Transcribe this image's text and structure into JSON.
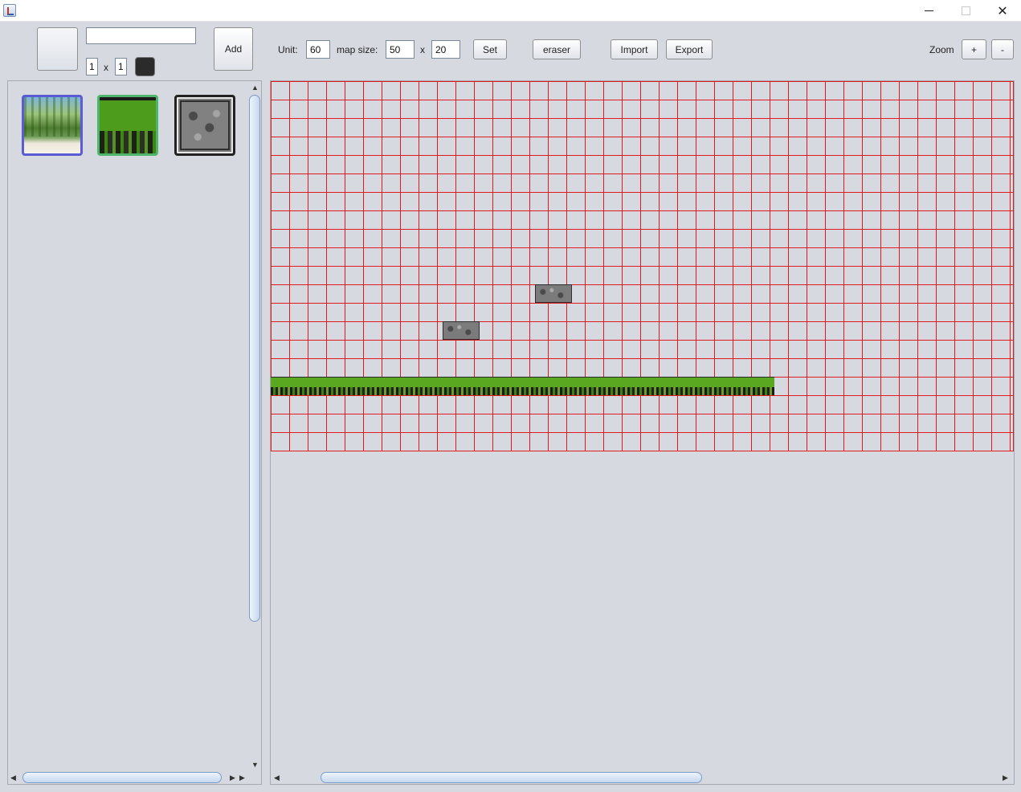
{
  "window": {
    "minimize_glyph": "",
    "maximize_glyph": "",
    "close_glyph": "✕"
  },
  "toolbar": {
    "name_value": "",
    "width_value": "1",
    "x_sep": "x",
    "height_value": "1",
    "add_label": "Add",
    "unit_label": "Unit:",
    "unit_value": "60",
    "map_size_label": "map size:",
    "map_width_value": "50",
    "map_x_sep": "x",
    "map_height_value": "20",
    "set_label": "Set",
    "eraser_label": "eraser",
    "import_label": "Import",
    "export_label": "Export",
    "zoom_label": "Zoom",
    "zoom_in_label": "+",
    "zoom_out_label": "-",
    "swatch_color": "#2b2b2b"
  },
  "palette": {
    "tiles": [
      {
        "icon": "jungle-background-tile",
        "selected": true
      },
      {
        "icon": "grass-tile",
        "selected": false
      },
      {
        "icon": "stone-tile",
        "selected": false
      }
    ]
  },
  "map": {
    "grid_color": "#e01b1b",
    "grid_columns": 40,
    "grid_rows": 20,
    "placed": [
      {
        "tile": "grass-tile",
        "col_start": 0,
        "col_end": 27,
        "row": 16
      },
      {
        "tile": "stone-tile",
        "col_start": 14,
        "col_end": 15,
        "row": 11
      },
      {
        "tile": "stone-tile",
        "col_start": 9,
        "col_end": 10,
        "row": 13
      }
    ]
  },
  "colors": {
    "background": "#d7d9e0",
    "selected_tile_border": "#5b5bd6"
  }
}
